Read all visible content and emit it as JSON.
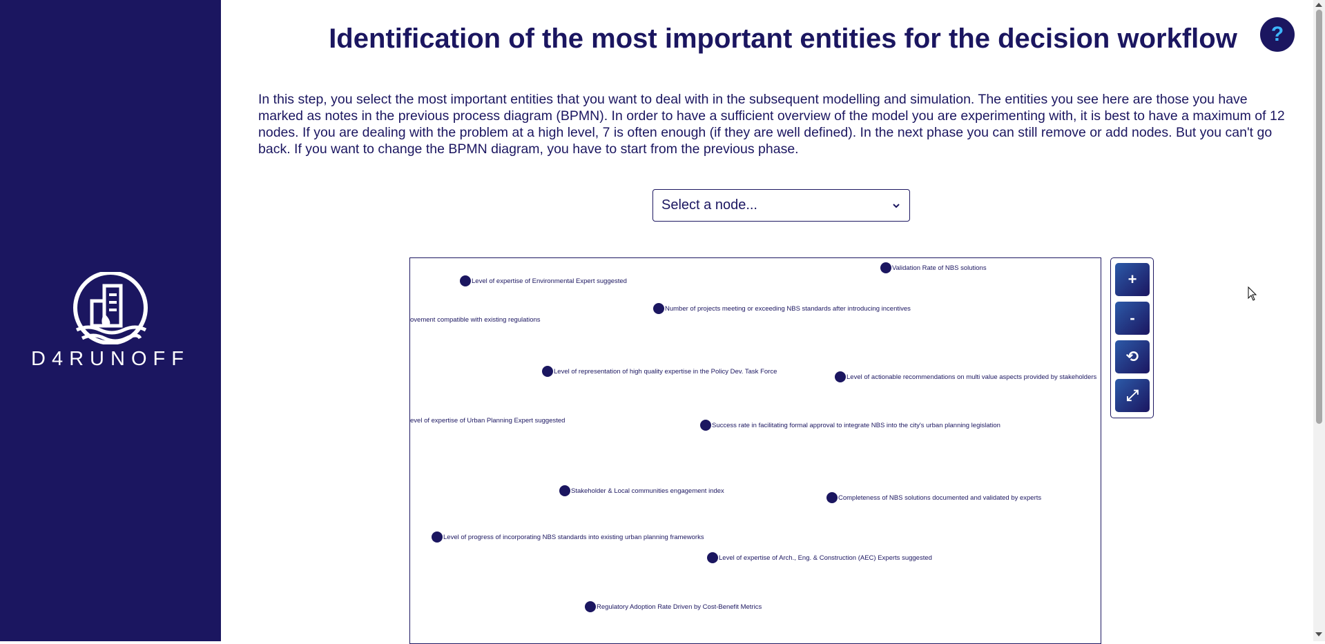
{
  "sidebar": {
    "logo_text": "D4RUNOFF"
  },
  "header": {
    "title": "Identification of the most important entities for the decision workflow",
    "help_label": "?"
  },
  "intro": "In this step, you select the most important entities that you want to deal with in the subsequent modelling and simulation. The entities you see here are those you have marked as notes in the previous process diagram (BPMN). In order to have a sufficient overview of the model you are experimenting with, it is best to have a maximum of 12 nodes. If you are dealing with the problem at a high level, 7 is often enough (if they are well defined). In the next phase you can still remove or add nodes. But you can't go back. If you want to change the BPMN diagram, you have to start from the previous phase.",
  "node_select": {
    "placeholder": "Select a node..."
  },
  "graph": {
    "nodes": [
      {
        "label": "Validation Rate of NBS solutions"
      },
      {
        "label": "Level of expertise of Environmental Expert  suggested"
      },
      {
        "label": "Number of projects meeting or exceeding NBS standards after introducing incentives"
      },
      {
        "label": "ovement compatible with existing regulations"
      },
      {
        "label": "Level of representation of high quality expertise in the Policy Dev. Task Force"
      },
      {
        "label": "Level of actionable recommendations on multi value aspects provided by stakeholders"
      },
      {
        "label": "evel of expertise of Urban Planning Expert suggested"
      },
      {
        "label": "Success rate in facilitating formal approval to integrate NBS into the city's urban planning legislation"
      },
      {
        "label": "Stakeholder & Local communities engagement index"
      },
      {
        "label": "Completeness of NBS solutions documented and validated by experts"
      },
      {
        "label": "Level of progress of incorporating NBS standards into existing urban planning frameworks"
      },
      {
        "label": "Level of expertise of Arch., Eng. & Construction (AEC) Experts suggested"
      },
      {
        "label": "Regulatory Adoption Rate Driven by Cost-Benefit Metrics"
      }
    ]
  },
  "controls": {
    "zoom_in": "+",
    "zoom_out": "-",
    "reset": "⟲",
    "fit": "⤢"
  }
}
